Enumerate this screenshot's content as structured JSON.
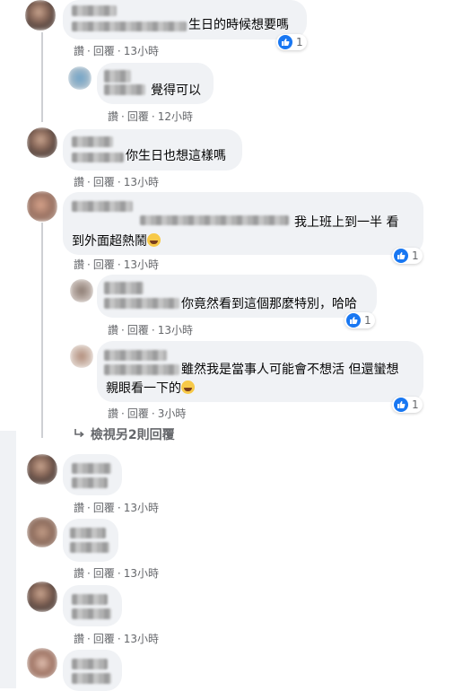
{
  "comments": [
    {
      "text": "生日的時候想要嗎",
      "read": "讚",
      "reply": "回覆",
      "time": "13小時",
      "reactions": "1"
    },
    {
      "text": "覺得可以",
      "read": "讚",
      "reply": "回覆",
      "time": "12小時"
    },
    {
      "text": "你生日也想這樣嗎",
      "read": "讚",
      "reply": "回覆",
      "time": "13小時"
    },
    {
      "text_line1": "我上班上到一半 看",
      "text_line2": "到外面超熱鬧",
      "read": "讚",
      "reply": "回覆",
      "time": "13小時",
      "reactions": "1"
    },
    {
      "text": "你竟然看到這個那麼特別，哈哈",
      "read": "讚",
      "reply": "回覆",
      "time": "13小時",
      "reactions": "1"
    },
    {
      "text_line1": "雖然我是當事人可能會不想活 但還蠻想",
      "text_line2": "親眼看一下的",
      "read": "讚",
      "reply": "回覆",
      "time": "3小時",
      "reactions": "1"
    },
    {
      "read": "讚",
      "reply": "回覆",
      "time": "13小時"
    },
    {
      "read": "讚",
      "reply": "回覆",
      "time": "13小時"
    },
    {
      "read": "讚",
      "reply": "回覆",
      "time": "13小時"
    }
  ],
  "more_replies": "檢視另2則回覆",
  "icons": {
    "like": "like-icon",
    "reply_arrow": "reply-arrow-icon",
    "emoji": "laughing-emoji-icon"
  },
  "colors": {
    "like_blue": "#1877f2",
    "bubble": "#f0f2f5",
    "meta": "#65676b"
  }
}
